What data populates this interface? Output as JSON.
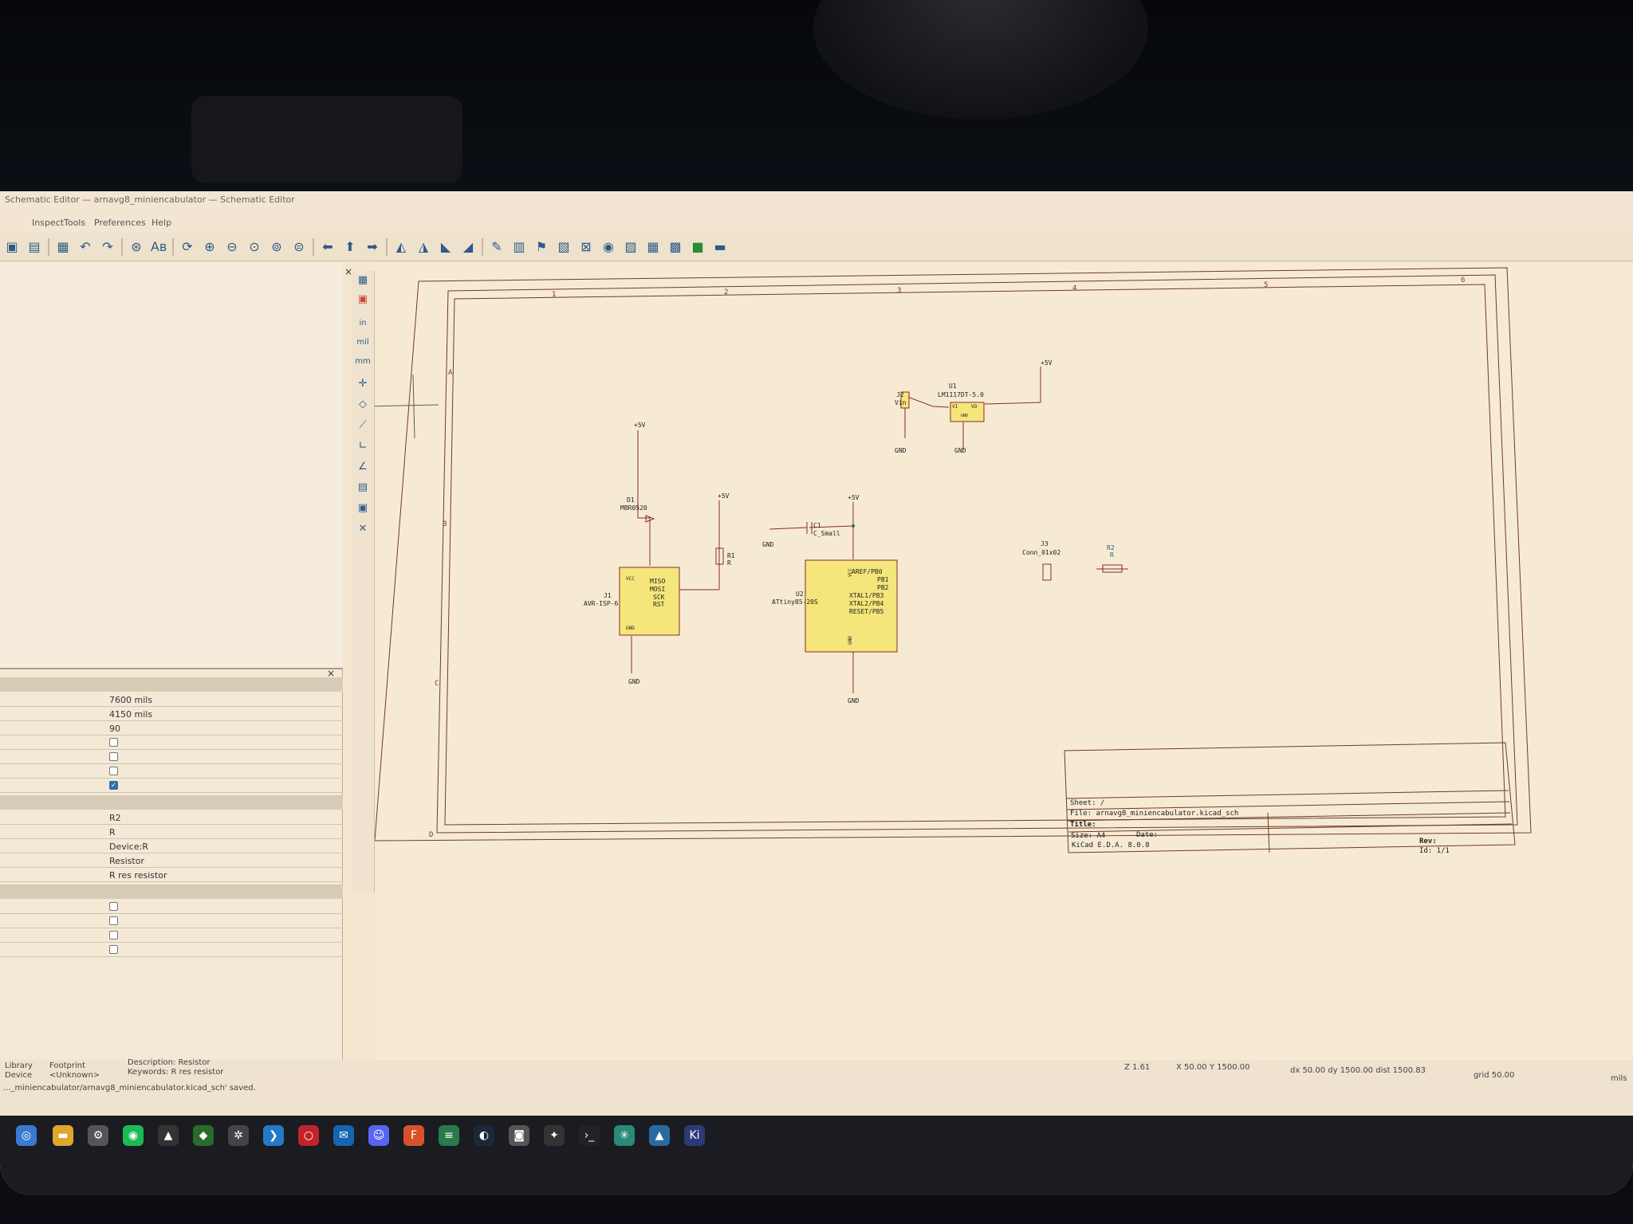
{
  "window": {
    "title": "Schematic Editor — arnavg8_miniencabulator — Schematic Editor",
    "menu": [
      "Inspect",
      "Tools",
      "Preferences",
      "Help"
    ]
  },
  "properties": {
    "position_x": "7600 mils",
    "position_y": "4150 mils",
    "orientation": "90",
    "reference": "R2",
    "value": "R",
    "library_link": "Device:R",
    "description": "Resistor",
    "keywords": "R res resistor"
  },
  "schematic": {
    "u1_ref": "U1",
    "u1_value": "LM1117DT-5.0",
    "u1_pin_vi": "VI",
    "u1_pin_vo": "VO",
    "u1_pin_gnd": "GND",
    "j2_ref": "J2",
    "j2_value": "Vin",
    "d1_ref": "D1",
    "d1_value": "MBR0520",
    "r1_ref": "R1",
    "r1_value": "R",
    "c1_ref": "C1",
    "c1_value": "C_Small",
    "j1_ref": "J1",
    "j1_value": "AVR-ISP-6",
    "j1_pins": [
      "MISO",
      "MOSI",
      "SCK",
      "RST"
    ],
    "j1_vcc": "VCC",
    "j1_gnd": "GND",
    "u2_ref": "U2",
    "u2_value": "ATtiny85-20S",
    "u2_pins": [
      "AREF/PB0",
      "PB1",
      "PB2",
      "XTAL1/PB3",
      "XTAL2/PB4",
      "RESET/PB5"
    ],
    "u2_vcc": "VCC",
    "u2_gnd": "GND",
    "j3_ref": "J3",
    "j3_value": "Conn_01x02",
    "r2_ref": "R2",
    "r2_value": "R",
    "power_5v": "+5V",
    "power_gnd": "GND",
    "frame_cols": [
      "1",
      "2",
      "3",
      "4",
      "5",
      "6"
    ],
    "frame_rows": [
      "A",
      "B",
      "C",
      "D"
    ]
  },
  "title_block": {
    "sheet": "Sheet: /",
    "file": "File: arnavg8_miniencabulator.kicad_sch",
    "title": "Title:",
    "size": "Size: A4",
    "date": "Date:",
    "kicad": "KiCad E.D.A. 8.0.8",
    "rev": "Rev:",
    "id": "Id: 1/1"
  },
  "status": {
    "library": "Library",
    "device": "Device",
    "footprint": "Footprint",
    "unknown": "<Unknown>",
    "description": "Description: Resistor",
    "keywords": "Keywords: R res resistor",
    "saved": "..._miniencabulator/arnavg8_miniencabulator.kicad_sch' saved.",
    "zoom": "Z 1.61",
    "cursor": "X 50.00  Y 1500.00",
    "delta": "dx 50.00  dy 1500.00  dist 1500.83",
    "grid": "grid 50.00",
    "units": "mils"
  },
  "toolbar_units": [
    "in",
    "mil",
    "mm"
  ]
}
